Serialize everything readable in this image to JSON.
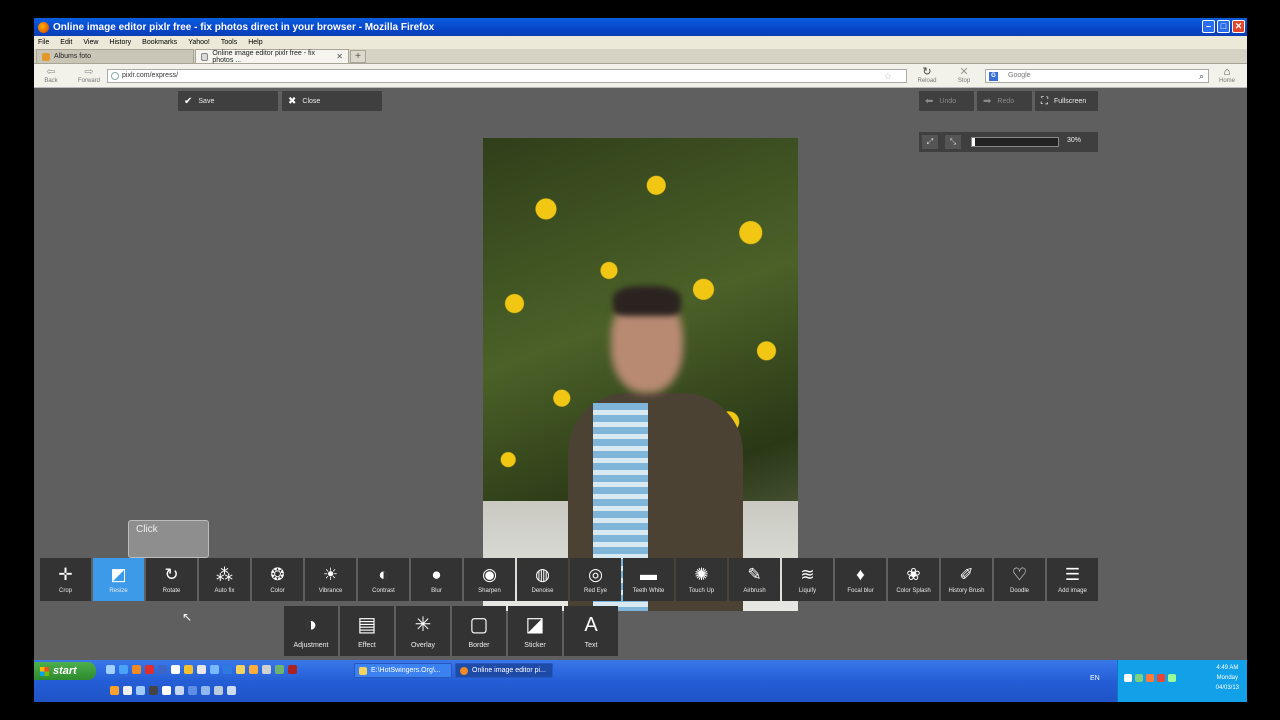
{
  "browser": {
    "title": "Online image editor pixlr free - fix photos direct in your browser - Mozilla Firefox",
    "menu": [
      "File",
      "Edit",
      "View",
      "History",
      "Bookmarks",
      "Yahoo!",
      "Tools",
      "Help"
    ],
    "tabs": [
      {
        "label": "Albums foto",
        "active": false
      },
      {
        "label": "Online image editor pixlr free - fix photos ...",
        "active": true
      }
    ],
    "nav": {
      "back": "Back",
      "forward": "Forward",
      "url": "pixlr.com/express/",
      "reload": "Reload",
      "stop": "Stop",
      "search_placeholder": "Google",
      "home": "Home"
    }
  },
  "editor": {
    "save": "Save",
    "close": "Close",
    "undo": "Undo",
    "redo": "Redo",
    "fullscreen": "Fullscreen",
    "zoom_percent": 30,
    "zoom_label": "30%",
    "tooltip": "Click",
    "tools": [
      {
        "label": "Crop",
        "icon": "crop-icon",
        "glyph": "✛",
        "active": false
      },
      {
        "label": "Resize",
        "icon": "resize-icon",
        "glyph": "◩",
        "active": true
      },
      {
        "label": "Rotate",
        "icon": "rotate-icon",
        "glyph": "↻",
        "active": false
      },
      {
        "label": "Auto fix",
        "icon": "autofix-icon",
        "glyph": "⁂",
        "active": false
      },
      {
        "label": "Color",
        "icon": "palette-icon",
        "glyph": "❂",
        "active": false
      },
      {
        "label": "Vibrance",
        "icon": "sun-icon",
        "glyph": "☀",
        "active": false
      },
      {
        "label": "Contrast",
        "icon": "contrast-icon",
        "glyph": "◐",
        "active": false
      },
      {
        "label": "Blur",
        "icon": "blur-icon",
        "glyph": "●",
        "active": false
      },
      {
        "label": "Sharpen",
        "icon": "sharpen-icon",
        "glyph": "◉",
        "active": false
      },
      {
        "label": "Denoise",
        "icon": "denoise-icon",
        "glyph": "◍",
        "active": false
      },
      {
        "label": "Red Eye",
        "icon": "eye-icon",
        "glyph": "◎",
        "active": false
      },
      {
        "label": "Teeth White",
        "icon": "toothbrush-icon",
        "glyph": "▬",
        "active": false
      },
      {
        "label": "Touch Up",
        "icon": "touchup-icon",
        "glyph": "✺",
        "active": false
      },
      {
        "label": "Airbrush",
        "icon": "airbrush-icon",
        "glyph": "✎",
        "active": false
      },
      {
        "label": "Liquify",
        "icon": "liquify-icon",
        "glyph": "≋",
        "active": false
      },
      {
        "label": "Focal blur",
        "icon": "drop-icon",
        "glyph": "♦",
        "active": false
      },
      {
        "label": "Color Splash",
        "icon": "flower-icon",
        "glyph": "❀",
        "active": false
      },
      {
        "label": "History Brush",
        "icon": "brush-icon",
        "glyph": "✐",
        "active": false
      },
      {
        "label": "Doodle",
        "icon": "doodle-icon",
        "glyph": "♡",
        "active": false
      },
      {
        "label": "Add image",
        "icon": "layers-icon",
        "glyph": "☰",
        "active": false
      }
    ],
    "categories": [
      {
        "label": "Adjustment",
        "icon": "adjustment-icon",
        "glyph": "◑"
      },
      {
        "label": "Effect",
        "icon": "film-icon",
        "glyph": "▤"
      },
      {
        "label": "Overlay",
        "icon": "bulb-icon",
        "glyph": "✳"
      },
      {
        "label": "Border",
        "icon": "border-icon",
        "glyph": "▢"
      },
      {
        "label": "Sticker",
        "icon": "sticker-icon",
        "glyph": "◪"
      },
      {
        "label": "Text",
        "icon": "text-icon",
        "glyph": "A"
      }
    ]
  },
  "taskbar": {
    "start": "start",
    "items": [
      {
        "label": "E:\\HotSwingers.Org\\...",
        "active": false
      },
      {
        "label": "Online image editor pi...",
        "active": true
      }
    ],
    "lang": "EN",
    "time": "4:49 AM",
    "day": "Monday",
    "date": "04/03/13"
  }
}
